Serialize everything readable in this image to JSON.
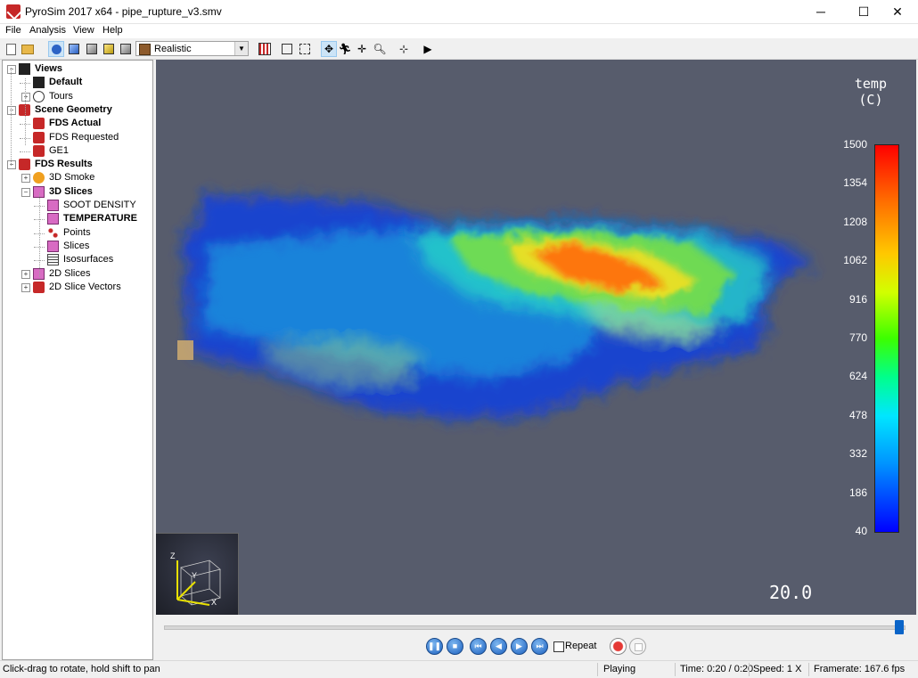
{
  "window": {
    "title": "PyroSim 2017 x64 - pipe_rupture_v3.smv",
    "minimize": "─",
    "maximize": "☐",
    "close": "✕"
  },
  "menu": [
    "File",
    "Analysis",
    "View",
    "Help"
  ],
  "toolbar": {
    "render_mode": "Realistic",
    "icons": [
      "new-file-icon",
      "open-folder-icon",
      "perspective-view-icon",
      "view-top-icon",
      "view-front-icon",
      "view-side-icon",
      "view-iso-icon",
      "grid-toggle-icon",
      "bounding-box-icon",
      "wireframe-icon",
      "orbit-icon",
      "walk-icon",
      "pan-icon",
      "zoom-icon",
      "roam-icon",
      "camera-icon"
    ]
  },
  "tree": {
    "items": [
      {
        "label": "Views",
        "level": 0,
        "bold": true,
        "expander": "−",
        "icon": "views-icon"
      },
      {
        "label": "Default",
        "level": 1,
        "bold": true,
        "expander": "",
        "icon": "camera-icon"
      },
      {
        "label": "Tours",
        "level": 1,
        "bold": false,
        "expander": "+",
        "icon": "tour-icon"
      },
      {
        "label": "Scene Geometry",
        "level": 0,
        "bold": true,
        "expander": "−",
        "icon": "geometry-icon"
      },
      {
        "label": "FDS Actual",
        "level": 1,
        "bold": true,
        "expander": "",
        "icon": "geometry-icon"
      },
      {
        "label": "FDS Requested",
        "level": 1,
        "bold": false,
        "expander": "",
        "icon": "geometry-icon"
      },
      {
        "label": "GE1",
        "level": 1,
        "bold": false,
        "expander": "",
        "icon": "geometry-icon"
      },
      {
        "label": "FDS Results",
        "level": 0,
        "bold": true,
        "expander": "−",
        "icon": "results-icon"
      },
      {
        "label": "3D Smoke",
        "level": 1,
        "bold": false,
        "expander": "+",
        "icon": "smoke-icon"
      },
      {
        "label": "3D Slices",
        "level": 1,
        "bold": true,
        "expander": "−",
        "icon": "slice-icon"
      },
      {
        "label": "SOOT DENSITY",
        "level": 2,
        "bold": false,
        "expander": "",
        "icon": "slice-icon"
      },
      {
        "label": "TEMPERATURE",
        "level": 2,
        "bold": true,
        "expander": "",
        "icon": "slice-icon"
      },
      {
        "label": "Points",
        "level": 2,
        "bold": false,
        "expander": "",
        "icon": "points-icon"
      },
      {
        "label": "Slices",
        "level": 2,
        "bold": false,
        "expander": "",
        "icon": "slice-icon"
      },
      {
        "label": "Isosurfaces",
        "level": 2,
        "bold": false,
        "expander": "",
        "icon": "isosurface-icon"
      },
      {
        "label": "2D Slices",
        "level": 1,
        "bold": false,
        "expander": "+",
        "icon": "slice-icon"
      },
      {
        "label": "2D Slice Vectors",
        "level": 1,
        "bold": false,
        "expander": "+",
        "icon": "geometry-icon"
      }
    ]
  },
  "viewport": {
    "legend_title": [
      "temp",
      "(C)"
    ],
    "legend_ticks": [
      "1500",
      "1354",
      "1208",
      "1062",
      "916",
      "770",
      "624",
      "478",
      "332",
      "186",
      "40"
    ],
    "time_display": "20.0",
    "axes": {
      "z": "Z",
      "y": "Y",
      "x": "X"
    }
  },
  "playback": {
    "progress": 1.0,
    "repeat_label": "Repeat",
    "repeat_checked": false
  },
  "status": {
    "hint": "Click-drag to rotate, hold shift to pan",
    "state": "Playing",
    "time": "Time: 0:20 / 0:20",
    "speed": "Speed: 1 X",
    "framerate": "Framerate: 167.6 fps"
  },
  "colors": {
    "viewport_bg": "#575c6c",
    "playback_blue": "#1a5fbf",
    "accent_red": "#c62828"
  }
}
